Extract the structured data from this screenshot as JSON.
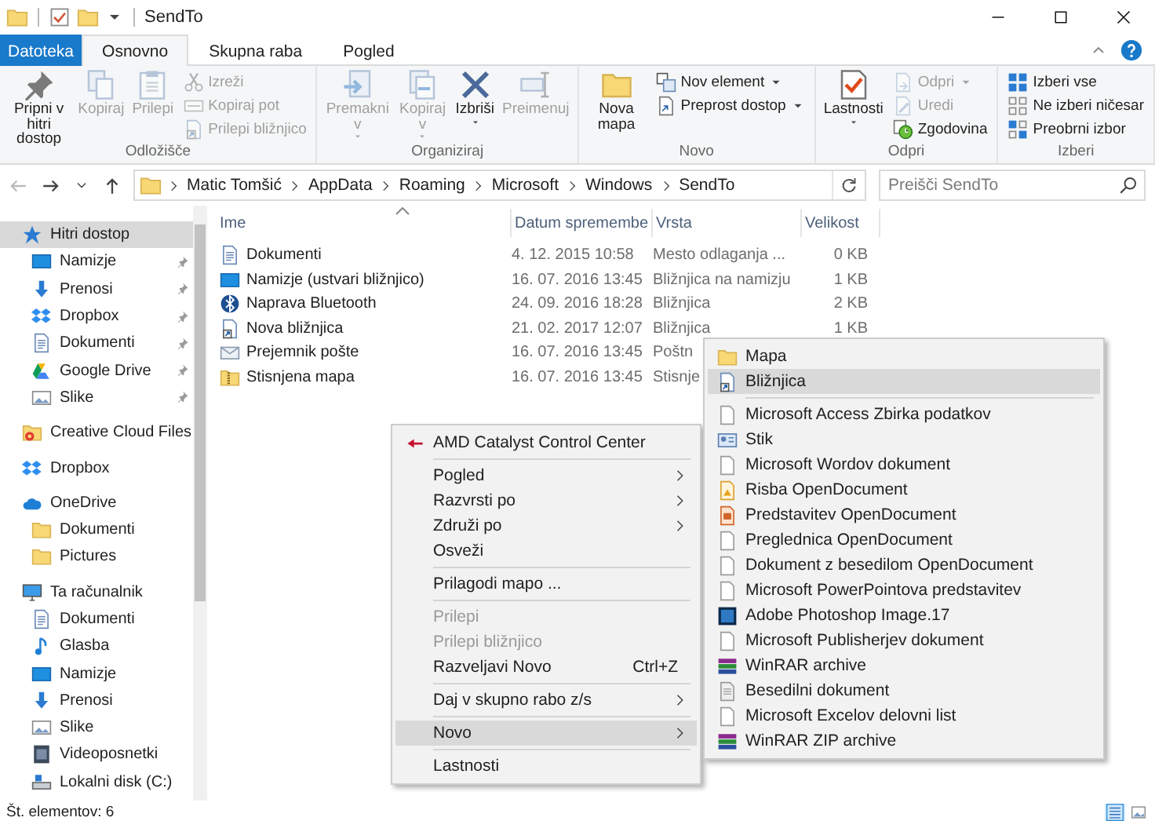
{
  "window": {
    "title": "SendTo"
  },
  "ribbon_tabs": [
    {
      "label": "Datoteka",
      "kind": "file",
      "selected": false
    },
    {
      "label": "Osnovno",
      "kind": "tab",
      "selected": true
    },
    {
      "label": "Skupna raba",
      "kind": "tab",
      "selected": false
    },
    {
      "label": "Pogled",
      "kind": "tab",
      "selected": false
    }
  ],
  "ribbon_groups": [
    {
      "label": "Odložišče",
      "large": [
        {
          "label": "Pripni v hitri dostop",
          "disabled": false,
          "dropdown": false
        },
        {
          "label": "Kopiraj",
          "disabled": true,
          "dropdown": false
        },
        {
          "label": "Prilepi",
          "disabled": true,
          "dropdown": false
        }
      ],
      "small": [
        {
          "label": "Izreži",
          "disabled": true,
          "dropdown": false
        },
        {
          "label": "Kopiraj pot",
          "disabled": true,
          "dropdown": false
        },
        {
          "label": "Prilepi bližnjico",
          "disabled": true,
          "dropdown": false
        }
      ]
    },
    {
      "label": "Organiziraj",
      "large": [
        {
          "label": "Premakni v",
          "disabled": true,
          "dropdown": true
        },
        {
          "label": "Kopiraj v",
          "disabled": true,
          "dropdown": true
        },
        {
          "label": "Izbriši",
          "disabled": false,
          "dropdown": true
        },
        {
          "label": "Preimenuj",
          "disabled": true,
          "dropdown": false
        }
      ]
    },
    {
      "label": "Novo",
      "large": [
        {
          "label": "Nova mapa",
          "disabled": false,
          "dropdown": false
        }
      ],
      "small": [
        {
          "label": "Nov element",
          "disabled": false,
          "dropdown": true
        },
        {
          "label": "Preprost dostop",
          "disabled": false,
          "dropdown": true
        }
      ]
    },
    {
      "label": "Odpri",
      "large": [
        {
          "label": "Lastnosti",
          "disabled": false,
          "dropdown": true
        }
      ],
      "small": [
        {
          "label": "Odpri",
          "disabled": true,
          "dropdown": true
        },
        {
          "label": "Uredi",
          "disabled": true,
          "dropdown": false
        },
        {
          "label": "Zgodovina",
          "disabled": false,
          "dropdown": false
        }
      ]
    },
    {
      "label": "Izberi",
      "small": [
        {
          "label": "Izberi vse",
          "disabled": false,
          "dropdown": false
        },
        {
          "label": "Ne izberi ničesar",
          "disabled": false,
          "dropdown": false
        },
        {
          "label": "Preobrni izbor",
          "disabled": false,
          "dropdown": false
        }
      ]
    }
  ],
  "back_button": {
    "disabled": true
  },
  "address": [
    "Matic Tomšić",
    "AppData",
    "Roaming",
    "Microsoft",
    "Windows",
    "SendTo"
  ],
  "search": {
    "placeholder": "Preišči SendTo"
  },
  "navigation": [
    {
      "label": "Hitri dostop",
      "selected": true,
      "children": [
        {
          "label": "Namizje",
          "selected": false,
          "pinned": true
        },
        {
          "label": "Prenosi",
          "selected": false,
          "pinned": true
        },
        {
          "label": "Dropbox",
          "selected": false,
          "pinned": true
        },
        {
          "label": "Dokumenti",
          "selected": false,
          "pinned": true
        },
        {
          "label": "Google Drive",
          "selected": false,
          "pinned": true
        },
        {
          "label": "Slike",
          "selected": false,
          "pinned": true
        }
      ]
    },
    {
      "label": "Creative Cloud Files",
      "selected": false
    },
    {
      "label": "Dropbox",
      "selected": false
    },
    {
      "label": "OneDrive",
      "selected": false,
      "children": [
        {
          "label": "Dokumenti",
          "selected": false,
          "pinned": false
        },
        {
          "label": "Pictures",
          "selected": false,
          "pinned": false
        }
      ]
    },
    {
      "label": "Ta računalnik",
      "selected": false,
      "children": [
        {
          "label": "Dokumenti",
          "selected": false,
          "pinned": false
        },
        {
          "label": "Glasba",
          "selected": false,
          "pinned": false
        },
        {
          "label": "Namizje",
          "selected": false,
          "pinned": false
        },
        {
          "label": "Prenosi",
          "selected": false,
          "pinned": false
        },
        {
          "label": "Slike",
          "selected": false,
          "pinned": false
        },
        {
          "label": "Videoposnetki",
          "selected": false,
          "pinned": false
        },
        {
          "label": "Lokalni disk (C:)",
          "selected": false,
          "pinned": false
        }
      ]
    }
  ],
  "table": {
    "columns": [
      "Ime",
      "Datum spremembe",
      "Vrsta",
      "Velikost"
    ],
    "rows": [
      {
        "name": "Dokumenti",
        "date": "4. 12. 2015 10:58",
        "type": "Mesto odlaganja ...",
        "size": "0 KB"
      },
      {
        "name": "Namizje (ustvari bližnjico)",
        "date": "16. 07. 2016 13:45",
        "type": "Bližnjica na namizju",
        "size": "1 KB"
      },
      {
        "name": "Naprava Bluetooth",
        "date": "24. 09. 2016 18:28",
        "type": "Bližnjica",
        "size": "2 KB"
      },
      {
        "name": "Nova bližnjica",
        "date": "21. 02. 2017 12:07",
        "type": "Bližnjica",
        "size": "1 KB"
      },
      {
        "name": "Prejemnik pošte",
        "date": "16. 07. 2016 13:45",
        "type": "Poštn"
      },
      {
        "name": "Stisnjena mapa",
        "date": "16. 07. 2016 13:45",
        "type": "Stisnje"
      }
    ]
  },
  "context_menu": [
    {
      "kind": "item",
      "label": "AMD Catalyst Control Center",
      "disabled": false,
      "submenu": false,
      "selected": false
    },
    {
      "kind": "separator"
    },
    {
      "kind": "item",
      "label": "Pogled",
      "disabled": false,
      "submenu": true,
      "selected": false
    },
    {
      "kind": "item",
      "label": "Razvrsti po",
      "disabled": false,
      "submenu": true,
      "selected": false
    },
    {
      "kind": "item",
      "label": "Združi po",
      "disabled": false,
      "submenu": true,
      "selected": false
    },
    {
      "kind": "item",
      "label": "Osveži",
      "disabled": false,
      "submenu": false,
      "selected": false
    },
    {
      "kind": "separator"
    },
    {
      "kind": "item",
      "label": "Prilagodi mapo ...",
      "disabled": false,
      "submenu": false,
      "selected": false
    },
    {
      "kind": "separator"
    },
    {
      "kind": "item",
      "label": "Prilepi",
      "disabled": true,
      "submenu": false,
      "selected": false
    },
    {
      "kind": "item",
      "label": "Prilepi bližnjico",
      "disabled": true,
      "submenu": false,
      "selected": false
    },
    {
      "kind": "item",
      "label": "Razveljavi Novo",
      "shortcut": "Ctrl+Z",
      "disabled": false,
      "submenu": false,
      "selected": false
    },
    {
      "kind": "separator"
    },
    {
      "kind": "item",
      "label": "Daj v skupno rabo z/s",
      "disabled": false,
      "submenu": true,
      "selected": false
    },
    {
      "kind": "separator"
    },
    {
      "kind": "item",
      "label": "Novo",
      "disabled": false,
      "submenu": true,
      "selected": true
    },
    {
      "kind": "separator"
    },
    {
      "kind": "item",
      "label": "Lastnosti",
      "disabled": false,
      "submenu": false,
      "selected": false
    }
  ],
  "submenu": [
    {
      "kind": "item",
      "label": "Mapa",
      "selected": false
    },
    {
      "kind": "item",
      "label": "Bližnjica",
      "selected": true
    },
    {
      "kind": "separator"
    },
    {
      "kind": "item",
      "label": "Microsoft Access Zbirka podatkov",
      "selected": false
    },
    {
      "kind": "item",
      "label": "Stik",
      "selected": false
    },
    {
      "kind": "item",
      "label": "Microsoft Wordov dokument",
      "selected": false
    },
    {
      "kind": "item",
      "label": "Risba OpenDocument",
      "selected": false
    },
    {
      "kind": "item",
      "label": "Predstavitev OpenDocument",
      "selected": false
    },
    {
      "kind": "item",
      "label": "Preglednica OpenDocument",
      "selected": false
    },
    {
      "kind": "item",
      "label": "Dokument z besedilom OpenDocument",
      "selected": false
    },
    {
      "kind": "item",
      "label": "Microsoft PowerPointova predstavitev",
      "selected": false
    },
    {
      "kind": "item",
      "label": "Adobe Photoshop Image.17",
      "selected": false
    },
    {
      "kind": "item",
      "label": "Microsoft Publisherjev dokument",
      "selected": false
    },
    {
      "kind": "item",
      "label": "WinRAR archive",
      "selected": false
    },
    {
      "kind": "item",
      "label": "Besedilni dokument",
      "selected": false
    },
    {
      "kind": "item",
      "label": "Microsoft Excelov delovni list",
      "selected": false
    },
    {
      "kind": "item",
      "label": "WinRAR ZIP archive",
      "selected": false
    }
  ],
  "status_bar": {
    "text": "Št. elementov: 6"
  },
  "view_buttons": [
    {
      "selected": true
    },
    {
      "selected": false
    }
  ]
}
